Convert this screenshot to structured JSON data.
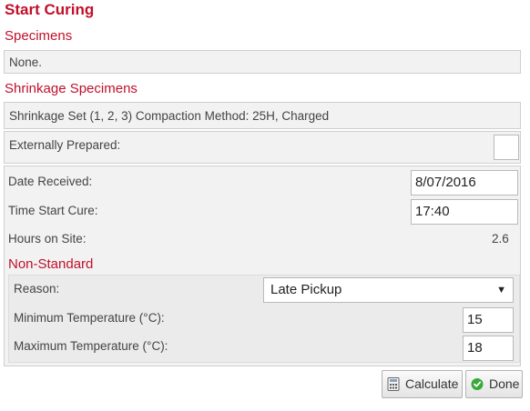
{
  "title": "Start Curing",
  "specimens": {
    "label": "Specimens",
    "value": "None."
  },
  "shrinkage": {
    "label": "Shrinkage Specimens",
    "value": "Shrinkage Set (1, 2, 3) Compaction Method: 25H, Charged"
  },
  "externally_prepared": {
    "label": "Externally Prepared:",
    "checked": false
  },
  "details": {
    "date_received_label": "Date Received:",
    "date_received": "8/07/2016",
    "time_start_label": "Time Start Cure:",
    "time_start": "17:40",
    "hours_label": "Hours on Site:",
    "hours": "2.6"
  },
  "non_standard": {
    "label": "Non-Standard",
    "reason_label": "Reason:",
    "reason": "Late Pickup",
    "min_temp_label": "Minimum Temperature (°C):",
    "min_temp": "15",
    "max_temp_label": "Maximum Temperature (°C):",
    "max_temp": "18"
  },
  "buttons": {
    "calculate": "Calculate",
    "done": "Done"
  },
  "colors": {
    "accent": "#c0102a",
    "done_icon": "#3aa83a"
  }
}
